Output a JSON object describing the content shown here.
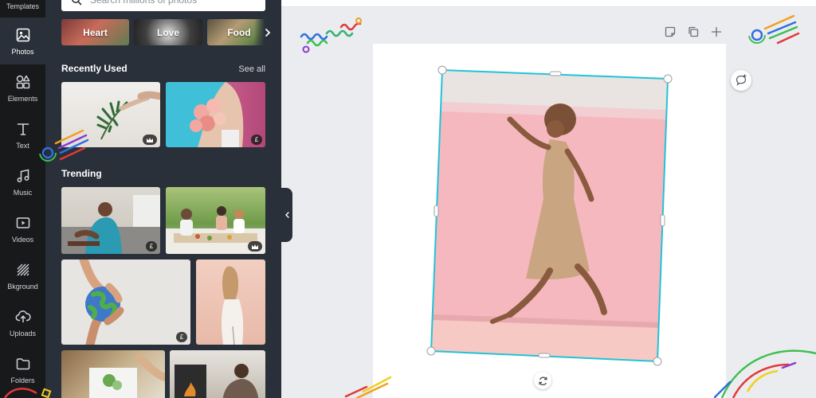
{
  "rail": {
    "templates": "Templates",
    "photos": "Photos",
    "elements": "Elements",
    "text": "Text",
    "music": "Music",
    "videos": "Videos",
    "background": "Bkground",
    "uploads": "Uploads",
    "folders": "Folders"
  },
  "search": {
    "placeholder": "Search millions of photos"
  },
  "chips": [
    "Heart",
    "Love",
    "Food"
  ],
  "recently_used": {
    "title": "Recently Used",
    "see_all": "See all"
  },
  "trending": {
    "title": "Trending"
  },
  "badges": {
    "pound": "£"
  },
  "colors": {
    "rail_bg": "#18191b",
    "panel_bg": "#293039",
    "canvas_bg": "#ebecf0",
    "selection": "#22c3d6"
  }
}
